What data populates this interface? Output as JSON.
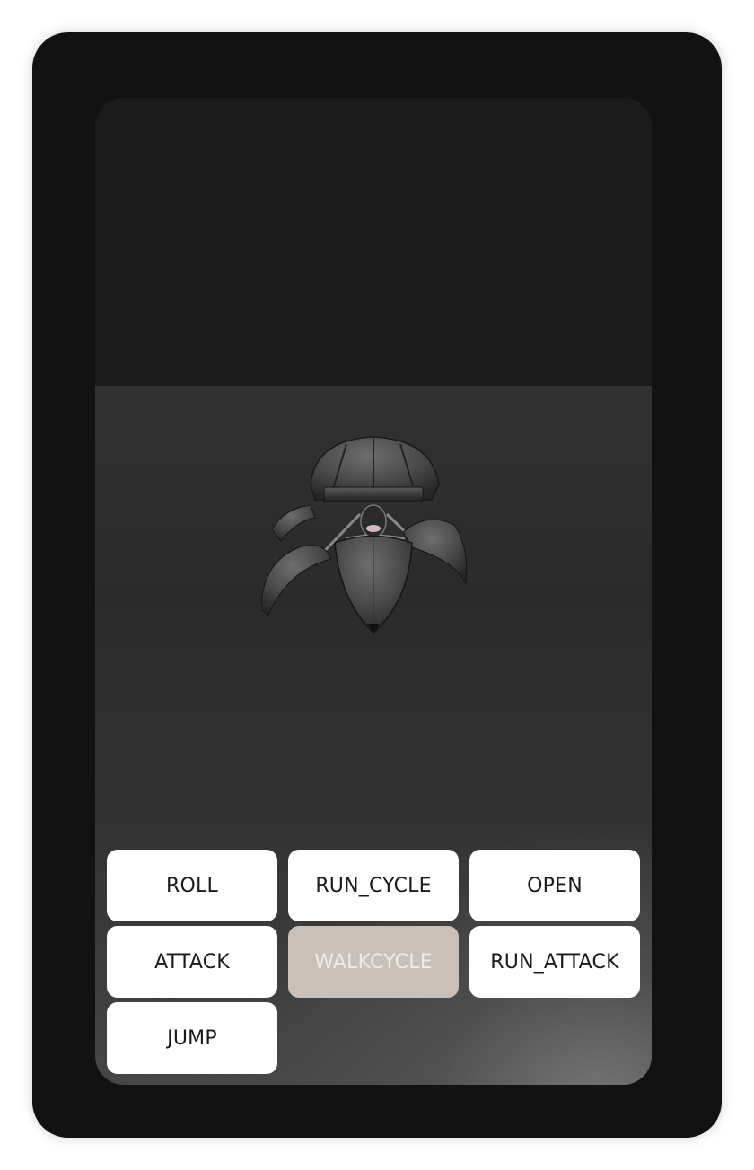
{
  "viewer": {
    "model_icon": "robot-model-icon"
  },
  "animations": [
    {
      "label": "ROLL",
      "active": true
    },
    {
      "label": "RUN_CYCLE",
      "active": true
    },
    {
      "label": "OPEN",
      "active": true
    },
    {
      "label": "ATTACK",
      "active": true
    },
    {
      "label": "WALKCYCLE",
      "active": false
    },
    {
      "label": "RUN_ATTACK",
      "active": true
    },
    {
      "label": "JUMP",
      "active": true
    }
  ],
  "colors": {
    "device_frame": "#121212",
    "top_area": "#1b1b1b",
    "button_bg": "#ffffff",
    "button_disabled_bg": "#c8c0b9",
    "button_disabled_text": "#efeae5"
  }
}
